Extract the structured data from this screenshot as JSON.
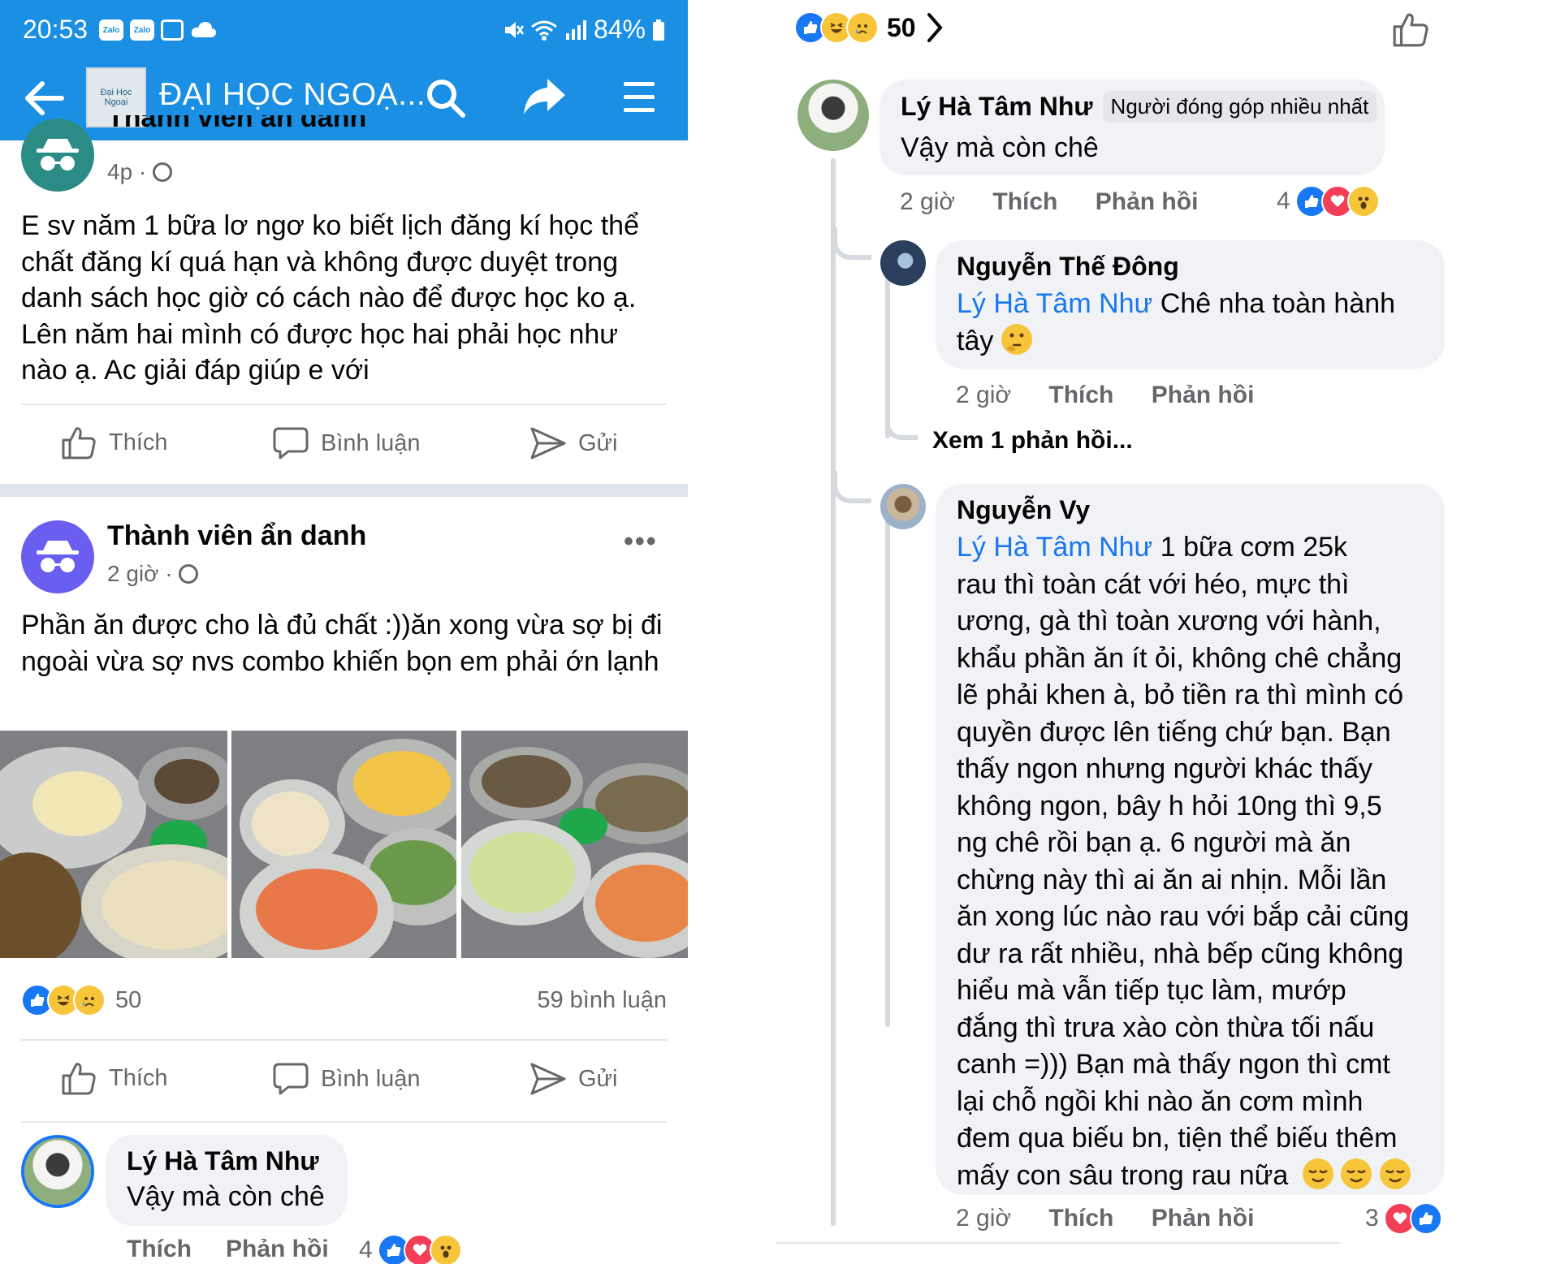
{
  "status_bar": {
    "time": "20:53",
    "battery": "84%",
    "icons": [
      "zalo-icon",
      "zalo-icon",
      "gallery-icon",
      "cloud-icon",
      "mute-icon",
      "wifi-icon",
      "signal-icon",
      "battery-icon"
    ]
  },
  "app_bar": {
    "title": "ĐẠI HỌC NGOẠ...",
    "logo_text": "Đại Học Ngoại"
  },
  "post1": {
    "author": "Thành viên ẩn danh",
    "time": "4p",
    "text": "E sv năm 1 bữa lơ ngơ ko biết lịch đăng kí học thể chất đăng kí quá hạn và không được duyệt trong danh sách học giờ có cách nào để được học ko ạ. Lên năm hai mình có được học hai phải học như nào ạ. Ac giải đáp giúp e với"
  },
  "actions": {
    "like": "Thích",
    "comment": "Bình luận",
    "send": "Gửi"
  },
  "post2": {
    "author": "Thành viên ẩn danh",
    "time": "2 giờ",
    "text": "Phần ăn được cho là đủ chất :))ăn xong vừa sợ bị đi ngoài vừa sợ nvs combo khiến bọn em phải ớn lạnh",
    "reaction_count": "50",
    "comment_count": "59 bình luận"
  },
  "left_comment": {
    "name": "Lý Hà Tâm Như",
    "text": "Vậy mà còn chê",
    "like": "Thích",
    "reply": "Phản hồi",
    "reaction_count": "4"
  },
  "right": {
    "reaction_count": "50",
    "comment1": {
      "name": "Lý Hà Tâm Như",
      "badge": "Người đóng góp nhiều nhất",
      "text": "Vậy mà còn chê",
      "time": "2 giờ",
      "like": "Thích",
      "reply": "Phản hồi",
      "reaction_count": "4"
    },
    "reply1": {
      "name": "Nguyễn Thế Đông",
      "mention": "Lý Hà Tâm Như",
      "text_line1": " Chê nha toàn hành",
      "text_line2": "tây",
      "time": "2 giờ",
      "like": "Thích",
      "reply": "Phản hồi"
    },
    "view_more": "Xem 1 phản hồi...",
    "reply2": {
      "name": "Nguyễn Vy",
      "mention": "Lý Hà Tâm Như",
      "lines": [
        " 1 bữa cơm 25k",
        "rau thì toàn cát với héo, mực thì",
        "ương, gà thì toàn xương với hành,",
        "khẩu phần ăn ít ỏi, không chê chẳng",
        "lẽ phải khen à, bỏ tiền ra thì mình có",
        "quyền được lên tiếng chứ bạn. Bạn",
        "thấy ngon nhưng người khác thấy",
        "không ngon, bây h hỏi 10ng thì 9,5",
        "ng chê rồi bạn ạ. 6 người mà ăn",
        "chừng này thì ai ăn ai nhịn. Mỗi lần",
        "ăn xong lúc nào rau với bắp cải cũng",
        "dư ra rất nhiều, nhà bếp cũng không",
        "hiểu mà vẫn tiếp tục làm, mướp",
        "đắng thì trưa xào còn thừa tối nấu",
        "canh =))) Bạn mà thấy ngon thì cmt",
        "lại chỗ ngồi khi nào ăn cơm mình",
        "đem qua biếu bn, tiện thể biếu thêm",
        "mấy con sâu trong rau nữa"
      ],
      "time": "2 giờ",
      "like": "Thích",
      "reply": "Phản hồi",
      "reaction_count": "3"
    }
  },
  "colors": {
    "brand": "#1a8fe3",
    "link": "#1877f2",
    "like_blue": "#1877f2",
    "love_red": "#f33e58",
    "bubble": "#f0f2f5",
    "meta_gray": "#65676b"
  }
}
